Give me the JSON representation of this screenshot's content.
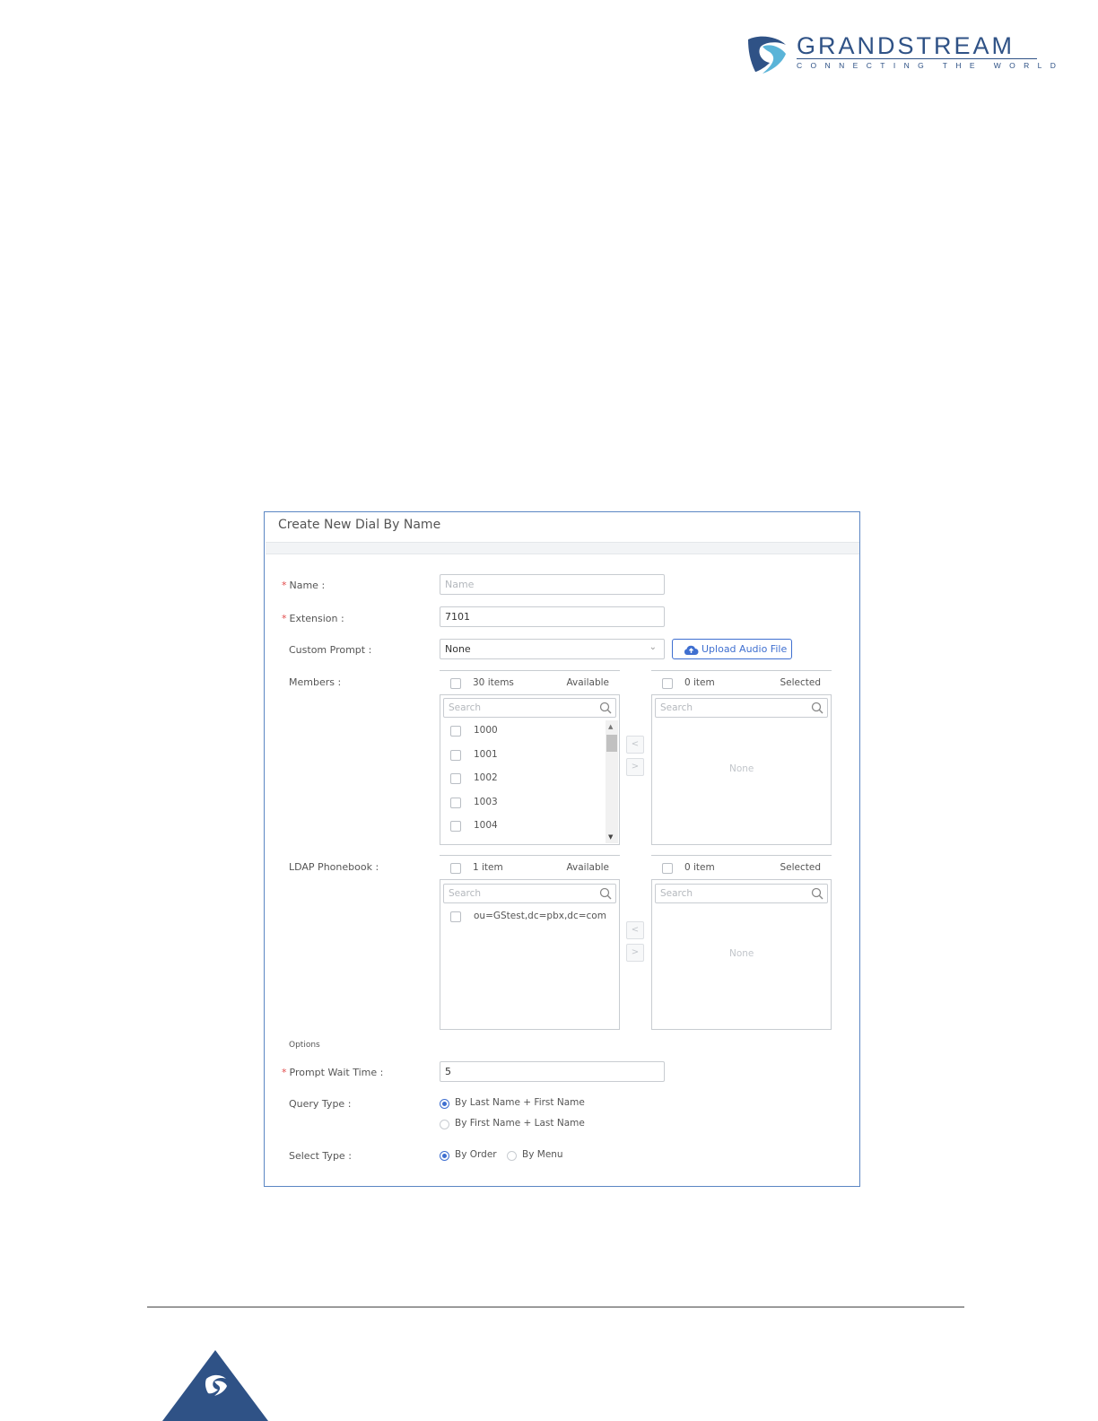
{
  "brand": {
    "name": "GRANDSTREAM",
    "tagline": "CONNECTING THE WORLD",
    "color": "#2f5286"
  },
  "dialog": {
    "title": "Create New Dial By Name",
    "border_color": "#5b86c3"
  },
  "form": {
    "name": {
      "label": "Name",
      "required": true,
      "placeholder": "Name",
      "value": ""
    },
    "extension": {
      "label": "Extension",
      "required": true,
      "value": "7101"
    },
    "custom_prompt": {
      "label": "Custom Prompt",
      "selected": "None",
      "upload_label": "Upload Audio File"
    },
    "members": {
      "label": "Members",
      "available": {
        "count_label": "30 items",
        "side_label": "Available",
        "search_placeholder": "Search",
        "items": [
          "1000",
          "1001",
          "1002",
          "1003",
          "1004"
        ]
      },
      "selected": {
        "count_label": "0 item",
        "side_label": "Selected",
        "search_placeholder": "Search",
        "empty_text": "None"
      },
      "move_left": "<",
      "move_right": ">"
    },
    "ldap": {
      "label": "LDAP Phonebook",
      "available": {
        "count_label": "1 item",
        "side_label": "Available",
        "search_placeholder": "Search",
        "items": [
          "ou=GStest,dc=pbx,dc=com"
        ]
      },
      "selected": {
        "count_label": "0 item",
        "side_label": "Selected",
        "search_placeholder": "Search",
        "empty_text": "None"
      },
      "move_left": "<",
      "move_right": ">"
    },
    "options_heading": "Options",
    "prompt_wait_time": {
      "label": "Prompt Wait Time",
      "required": true,
      "value": "5"
    },
    "query_type": {
      "label": "Query Type",
      "options": [
        "By Last Name + First Name",
        "By First Name + Last Name"
      ],
      "selected_index": 0
    },
    "select_type": {
      "label": "Select Type",
      "options": [
        "By Order",
        "By Menu"
      ],
      "selected_index": 0
    }
  },
  "colors": {
    "accent": "#3f6fd0",
    "required": "#e24b4b"
  }
}
